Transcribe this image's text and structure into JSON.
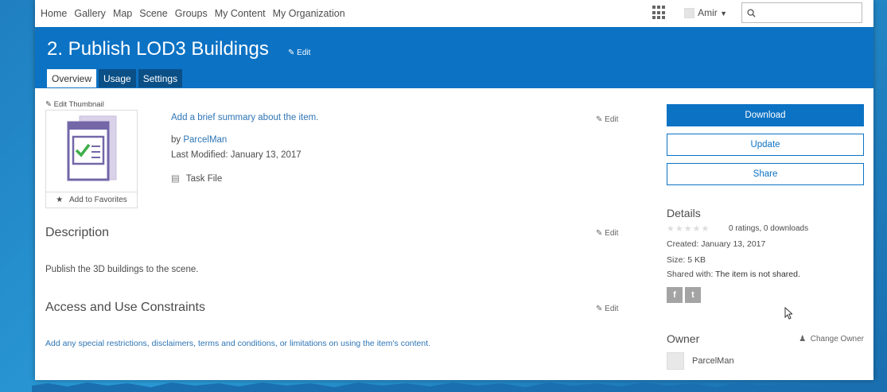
{
  "topnav": {
    "links": [
      "Home",
      "Gallery",
      "Map",
      "Scene",
      "Groups",
      "My Content",
      "My Organization"
    ],
    "user": "Amir",
    "search_placeholder": ""
  },
  "banner": {
    "title": "2. Publish LOD3 Buildings",
    "edit_label": "Edit",
    "tabs": [
      {
        "label": "Overview",
        "active": true
      },
      {
        "label": "Usage",
        "active": false
      },
      {
        "label": "Settings",
        "active": false
      }
    ]
  },
  "item": {
    "edit_thumbnail": "Edit Thumbnail",
    "add_favorites": "Add to Favorites",
    "summary_placeholder": "Add a brief summary about the item.",
    "by_prefix": "by ",
    "owner": "ParcelMan",
    "last_modified": "Last Modified: January 13, 2017",
    "type": "Task File",
    "edit_label": "Edit"
  },
  "description": {
    "title": "Description",
    "text": "Publish the 3D buildings to the scene."
  },
  "constraints": {
    "title": "Access and Use Constraints",
    "placeholder": "Add any special restrictions, disclaimers, terms and conditions, or limitations on using the item's content."
  },
  "actions": {
    "download": "Download",
    "update": "Update",
    "share": "Share"
  },
  "details": {
    "title": "Details",
    "ratings": "0 ratings, 0 downloads",
    "created": "Created: January 13, 2017",
    "size": "Size: 5 KB",
    "shared_prefix": "Shared with: ",
    "shared_value": "The item is not shared."
  },
  "owner_section": {
    "title": "Owner",
    "change_owner": "Change Owner",
    "name": "ParcelMan"
  },
  "colors": {
    "brand_blue": "#0c72c4",
    "link_blue": "#2e75b6",
    "tab_dark": "#0a4f86"
  }
}
